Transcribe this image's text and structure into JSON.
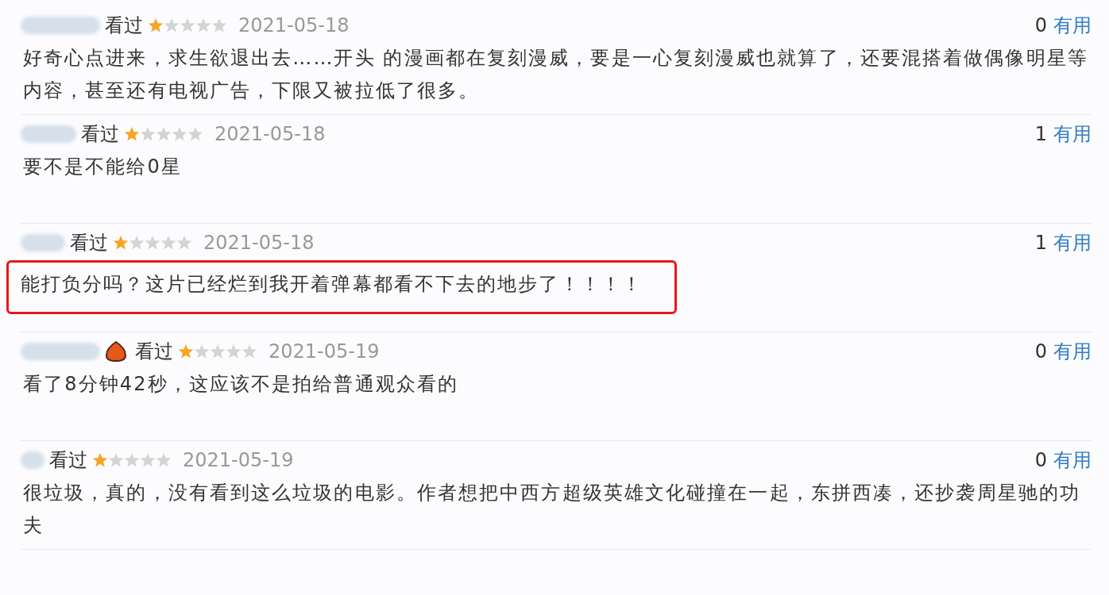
{
  "comments": [
    {
      "status": "看过",
      "stars": 1,
      "date": "2021-05-18",
      "votes": "0",
      "vote_label": "有用",
      "badge": false,
      "highlighted": false,
      "text": "好奇心点进来，求生欲退出去……开头 的漫画都在复刻漫威，要是一心复刻漫威也就算了，还要混搭着做偶像明星等内容，甚至还有电视广告，下限又被拉低了很多。"
    },
    {
      "status": "看过",
      "stars": 1,
      "date": "2021-05-18",
      "votes": "1",
      "vote_label": "有用",
      "badge": false,
      "highlighted": false,
      "text": "要不是不能给0星"
    },
    {
      "status": "看过",
      "stars": 1,
      "date": "2021-05-18",
      "votes": "1",
      "vote_label": "有用",
      "badge": false,
      "highlighted": true,
      "text": "能打负分吗？这片已经烂到我开着弹幕都看不下去的地步了！！！！"
    },
    {
      "status": "看过",
      "stars": 1,
      "date": "2021-05-19",
      "votes": "0",
      "vote_label": "有用",
      "badge": true,
      "highlighted": false,
      "text": "看了8分钟42秒，这应该不是拍给普通观众看的"
    },
    {
      "status": "看过",
      "stars": 1,
      "date": "2021-05-19",
      "votes": "0",
      "vote_label": "有用",
      "badge": false,
      "highlighted": false,
      "text": "很垃圾，真的，没有看到这么垃圾的电影。作者想把中西方超级英雄文化碰撞在一起，东拼西凑，还抄袭周星驰的功夫"
    }
  ]
}
